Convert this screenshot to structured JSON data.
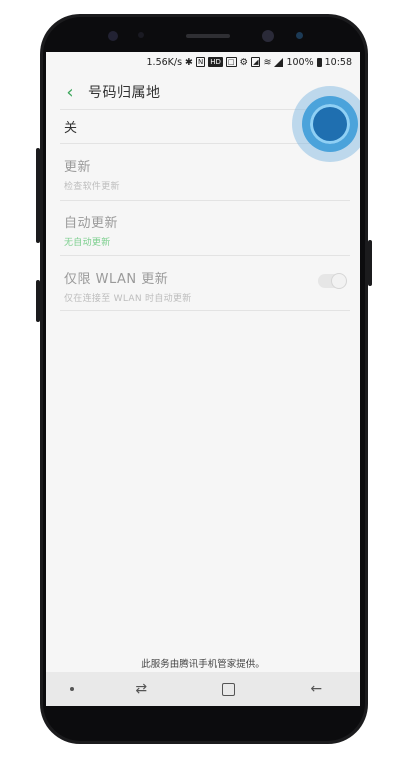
{
  "status_bar": {
    "speed": "1.56K/s",
    "hd_badge": "HD",
    "battery": "100%",
    "time": "10:58"
  },
  "header": {
    "title": "号码归属地"
  },
  "toggle_row": {
    "label": "关",
    "state": "off"
  },
  "settings": [
    {
      "title": "更新",
      "subtitle": "检查软件更新"
    },
    {
      "title": "自动更新",
      "subtitle": "无自动更新"
    },
    {
      "title": "仅限 WLAN 更新",
      "subtitle": "仅在连接至 WLAN 时自动更新",
      "switch": "off"
    }
  ],
  "footer": {
    "text": "此服务由腾讯手机管家提供。"
  },
  "colors": {
    "accent_green": "#3aa55a",
    "subtitle_green": "#7ccf8e",
    "tap_indicator": "#4ba3db"
  },
  "icons": {
    "back": "chevron-left-icon",
    "nav": [
      "dot-icon",
      "recents-icon",
      "home-icon",
      "back-arrow-icon"
    ]
  }
}
